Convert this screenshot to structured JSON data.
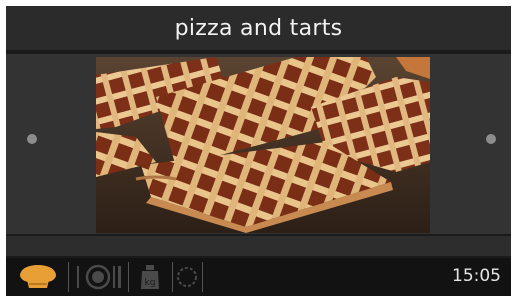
{
  "header": {
    "title": "pizza and tarts"
  },
  "carousel": {
    "prev_icon": "dot-icon",
    "next_icon": "dot-icon",
    "image_subject": "lattice-tart"
  },
  "toolbar": {
    "items": [
      {
        "icon": "chef-hat-icon",
        "active": true,
        "color": "#e8a036"
      },
      {
        "icon": "plate-cutlery-icon",
        "active": false
      },
      {
        "icon": "weight-icon",
        "active": false
      },
      {
        "icon": "timer-icon",
        "active": false
      }
    ]
  },
  "status": {
    "time": "15:05"
  },
  "colors": {
    "accent": "#e8a036",
    "inactive_icon": "#4a4a4a"
  }
}
